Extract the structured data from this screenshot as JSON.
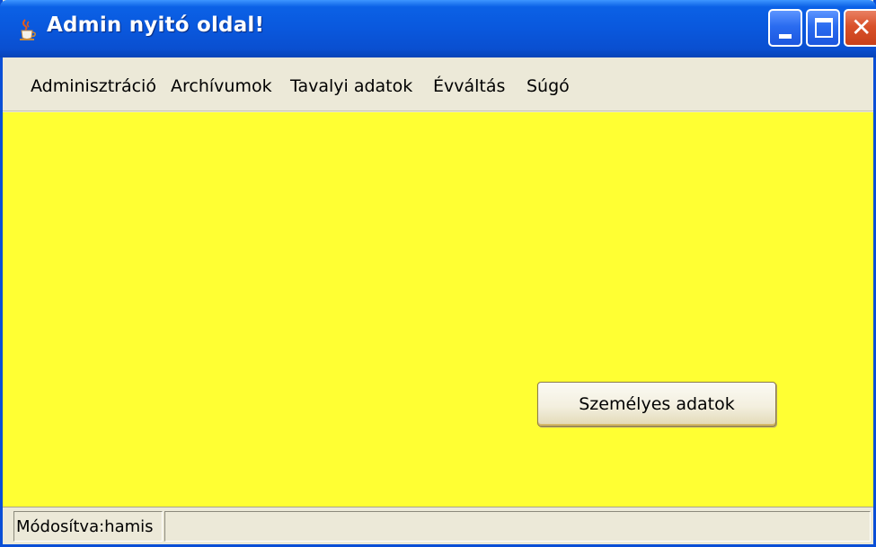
{
  "window": {
    "title": "Admin nyitó oldal!",
    "icon": "java-cup-icon",
    "controls": [
      "minimize-icon",
      "maximize-icon",
      "close-icon"
    ]
  },
  "menu": {
    "items": [
      {
        "label": "Adminisztráció"
      },
      {
        "label": "Archívumok"
      },
      {
        "label": "Tavalyi adatok"
      },
      {
        "label": "Évváltás"
      },
      {
        "label": "Súgó"
      }
    ]
  },
  "main": {
    "background_color": "#ffff33",
    "personal_data_button": "Személyes adatok"
  },
  "statusbar": {
    "modified_text": "Módosítva:hamis",
    "second_cell_text": ""
  },
  "colors": {
    "titlebar": "#0a58dd",
    "window_chrome": "#ece9d8",
    "close_button": "#d9512a"
  }
}
